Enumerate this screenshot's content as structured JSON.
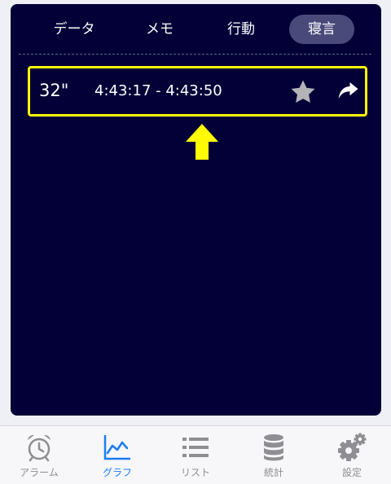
{
  "tabs": [
    {
      "label": "データ"
    },
    {
      "label": "メモ"
    },
    {
      "label": "行動"
    },
    {
      "label": "寝言"
    }
  ],
  "active_tab": "寝言",
  "record": {
    "duration": "32\"",
    "time_range": "4:43:17 - 4:43:50",
    "actions": [
      "star-icon",
      "share-icon"
    ]
  },
  "tabbar": {
    "items": [
      {
        "label": "アラーム",
        "icon": "alarm-clock-icon"
      },
      {
        "label": "グラフ",
        "icon": "chart-icon"
      },
      {
        "label": "リスト",
        "icon": "list-icon"
      },
      {
        "label": "統計",
        "icon": "database-icon"
      },
      {
        "label": "設定",
        "icon": "gear-icon"
      }
    ],
    "active": "グラフ"
  },
  "colors": {
    "panel_background": "#020037",
    "highlight": "#fffb00",
    "active_tab": "#4a4a7a",
    "tabbar_active": "#1a7cf2",
    "tabbar_inactive": "#8e8e93"
  }
}
